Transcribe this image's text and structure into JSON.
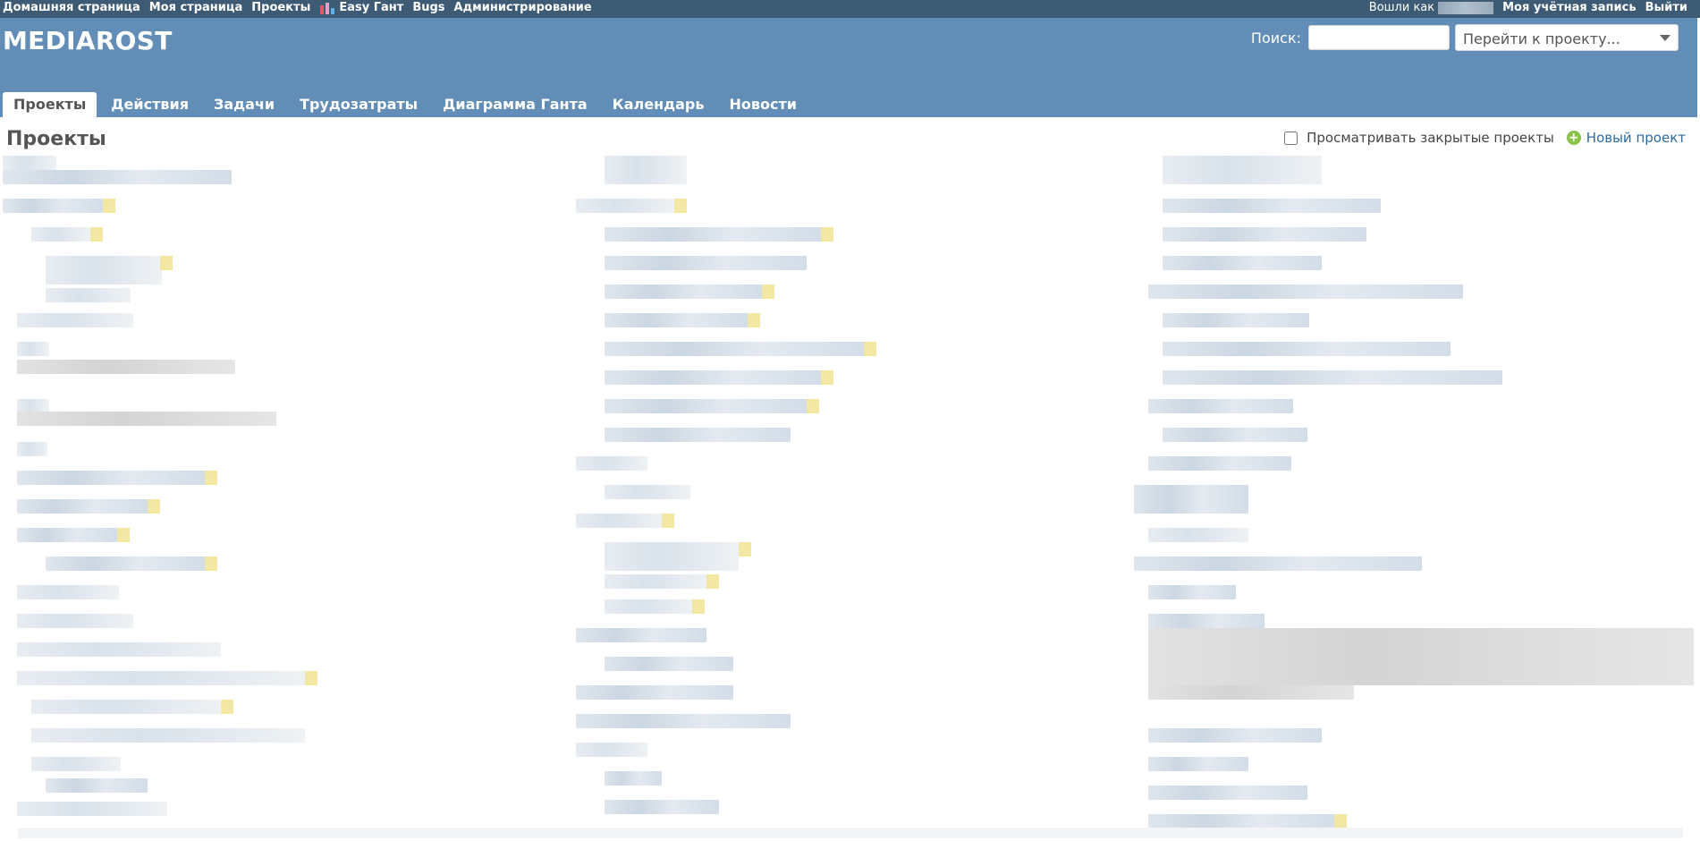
{
  "top_menu": {
    "items": [
      "Домашняя страница",
      "Моя страница",
      "Проекты",
      "Easy Гант",
      "Bugs",
      "Администрирование"
    ],
    "logged_as": "Вошли как",
    "my_account": "Моя учётная запись",
    "logout": "Выйти"
  },
  "header": {
    "title": "MEDIAROST",
    "search_label": "Поиск:",
    "search_value": "",
    "jump_placeholder": "Перейти к проекту..."
  },
  "main_menu": {
    "tabs": [
      "Проекты",
      "Действия",
      "Задачи",
      "Трудозатраты",
      "Диаграмма Ганта",
      "Календарь",
      "Новости"
    ],
    "selected": "Проекты"
  },
  "content": {
    "title": "Проекты",
    "show_closed_label": "Просматривать закрытые проекты",
    "show_closed_checked": false,
    "new_project_label": "Новый проект"
  },
  "colors": {
    "top_bar": "#3e5b76",
    "header": "#628db6",
    "link": "#2d6aa0"
  }
}
